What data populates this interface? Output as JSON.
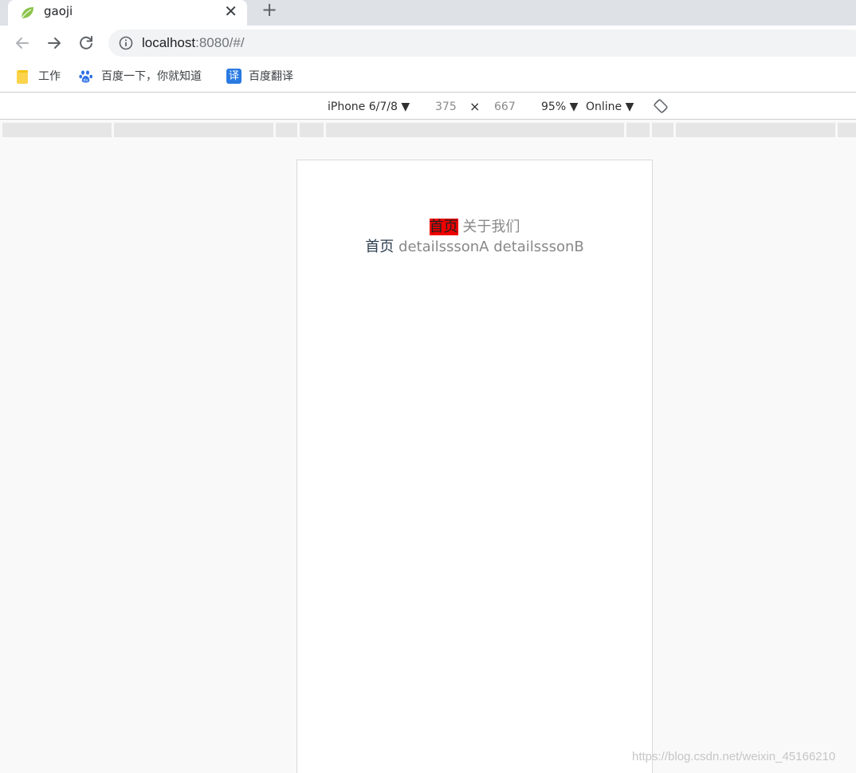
{
  "browser": {
    "tab": {
      "title": "gaoji",
      "close_glyph": "✕",
      "favicon": "leaf-icon"
    },
    "new_tab_glyph": "+",
    "address": {
      "host": "localhost",
      "rest": ":8080/#/"
    },
    "bookmarks": [
      {
        "label": "工作",
        "icon": "folder-icon"
      },
      {
        "label": "百度一下，你就知道",
        "icon": "baidu-paw-icon"
      },
      {
        "label": "百度翻译",
        "icon": "translate-icon",
        "icon_text": "译"
      }
    ]
  },
  "device_toolbar": {
    "device": "iPhone 6/7/8 ▼",
    "width": "375",
    "times": "×",
    "height": "667",
    "zoom": "95% ▼",
    "throttle": "Online ▼"
  },
  "page": {
    "nav1": {
      "active": "首页",
      "other": "关于我们"
    },
    "nav2": {
      "home": "首页",
      "link_a": "detailsssonA",
      "link_b": "detailsssonB"
    }
  },
  "watermark": "https://blog.csdn.net/weixin_45166210",
  "colors": {
    "active_link_bg": "#ee0000",
    "link_gray": "#888888",
    "tabstrip": "#dee1e6"
  }
}
